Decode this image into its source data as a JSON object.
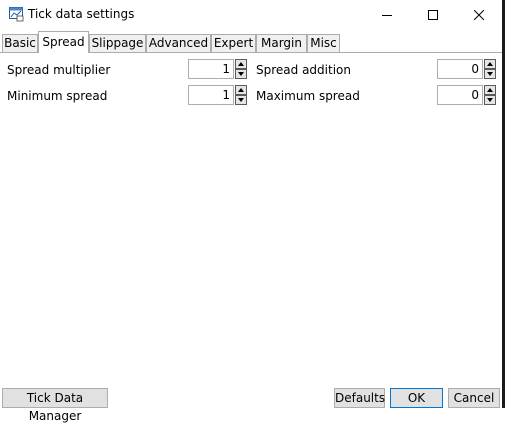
{
  "window": {
    "title": "Tick data settings"
  },
  "tabs": [
    {
      "label": "Basic",
      "active": false
    },
    {
      "label": "Spread",
      "active": true
    },
    {
      "label": "Slippage",
      "active": false
    },
    {
      "label": "Advanced",
      "active": false
    },
    {
      "label": "Expert",
      "active": false
    },
    {
      "label": "Margin",
      "active": false
    },
    {
      "label": "Misc",
      "active": false
    }
  ],
  "spread": {
    "spread_multiplier": {
      "label": "Spread multiplier",
      "value": "1"
    },
    "minimum_spread": {
      "label": "Minimum spread",
      "value": "1"
    },
    "spread_addition": {
      "label": "Spread addition",
      "value": "0"
    },
    "maximum_spread": {
      "label": "Maximum spread",
      "value": "0"
    }
  },
  "footer": {
    "tick_data_manager": "Tick Data Manager",
    "defaults": "Defaults",
    "ok": "OK",
    "cancel": "Cancel"
  }
}
